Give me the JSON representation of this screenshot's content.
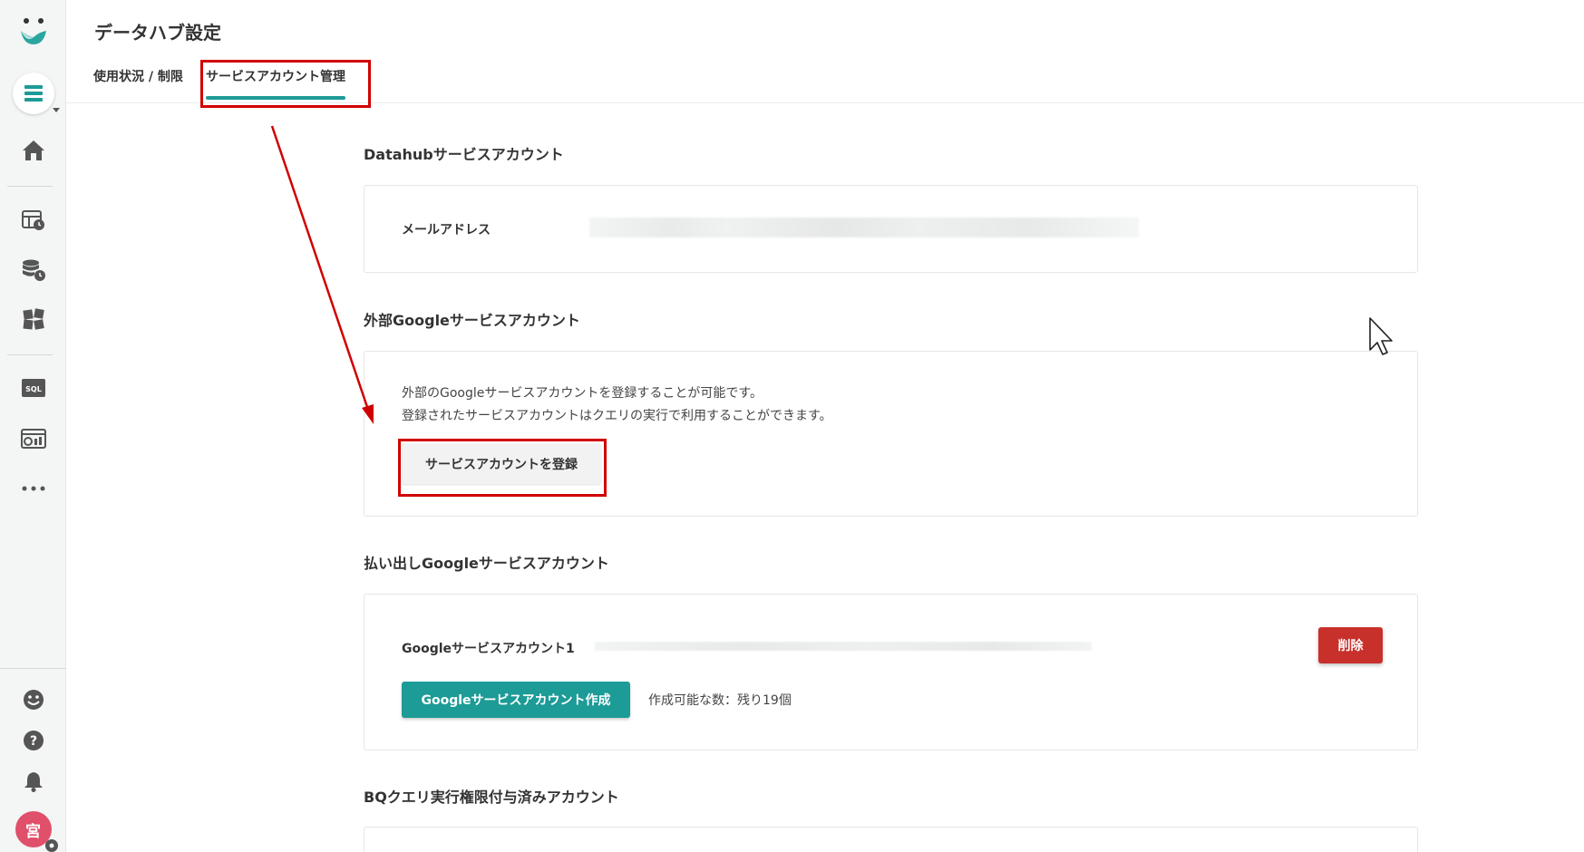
{
  "colors": {
    "accent": "#1d9b96",
    "danger": "#c8302b",
    "highlight": "#d00000",
    "avatar": "#e0506a"
  },
  "sidebar": {
    "icons": [
      "logo-icon",
      "menu-icon",
      "home-icon",
      "table-icon",
      "database-clock-icon",
      "puzzle-icon",
      "sql-icon",
      "dashboard-icon",
      "more-icon",
      "smile-icon",
      "help-icon",
      "bell-icon"
    ],
    "avatar_initial": "宮"
  },
  "header": {
    "title": "データハブ設定",
    "tabs": [
      {
        "label": "使用状況 / 制限"
      },
      {
        "label": "サービスアカウント管理"
      }
    ]
  },
  "datahub_section": {
    "title": "Datahubサービスアカウント",
    "email_label": "メールアドレス"
  },
  "external_section": {
    "title": "外部Googleサービスアカウント",
    "description_line1": "外部のGoogleサービスアカウントを登録することが可能です。",
    "description_line2": "登録されたサービスアカウントはクエリの実行で利用することができます。",
    "register_button": "サービスアカウントを登録"
  },
  "payout_section": {
    "title": "払い出しGoogleサービスアカウント",
    "account_label": "Googleサービスアカウント1",
    "delete_button": "削除",
    "create_button": "Googleサービスアカウント作成",
    "remaining_text": "作成可能な数：残り19個"
  },
  "bq_section": {
    "title": "BQクエリ実行権限付与済みアカウント"
  }
}
